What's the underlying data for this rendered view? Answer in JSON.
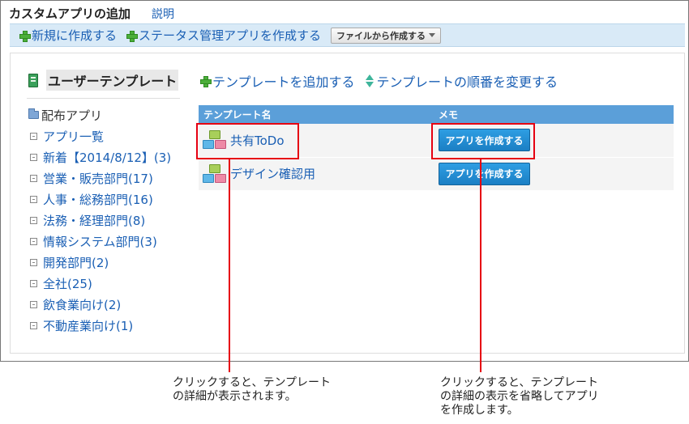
{
  "header": {
    "title": "カスタムアプリの追加",
    "help_label": "説明"
  },
  "toolbar": {
    "new_label": "新規に作成する",
    "status_label": "ステータス管理アプリを作成する",
    "file_label": "ファイルから作成する"
  },
  "sidebar": {
    "title": "ユーザーテンプレート",
    "root_label": "配布アプリ",
    "items": [
      "アプリ一覧",
      "新着【2014/8/12】(3)",
      "営業・販売部門(17)",
      "人事・総務部門(16)",
      "法務・経理部門(8)",
      "情報システム部門(3)",
      "開発部門(2)",
      "全社(25)",
      "飲食業向け(2)",
      "不動産業向け(1)"
    ]
  },
  "main": {
    "add_template_label": "テンプレートを追加する",
    "reorder_label": "テンプレートの順番を変更する",
    "columns": {
      "name": "テンプレート名",
      "memo": "メモ"
    },
    "rows": [
      {
        "name": "共有ToDo",
        "button": "アプリを作成する"
      },
      {
        "name": "デザイン確認用",
        "button": "アプリを作成する"
      }
    ]
  },
  "annotations": {
    "left": "クリックすると、テンプレート\nの詳細が表示されます。",
    "right": "クリックすると、テンプレート\nの詳細の表示を省略してアプリ\nを作成します。"
  },
  "colors": {
    "highlight": "#e60012",
    "table_header": "#5b9fd9",
    "button": "#1b7fc4",
    "link": "#1a5fb4"
  }
}
